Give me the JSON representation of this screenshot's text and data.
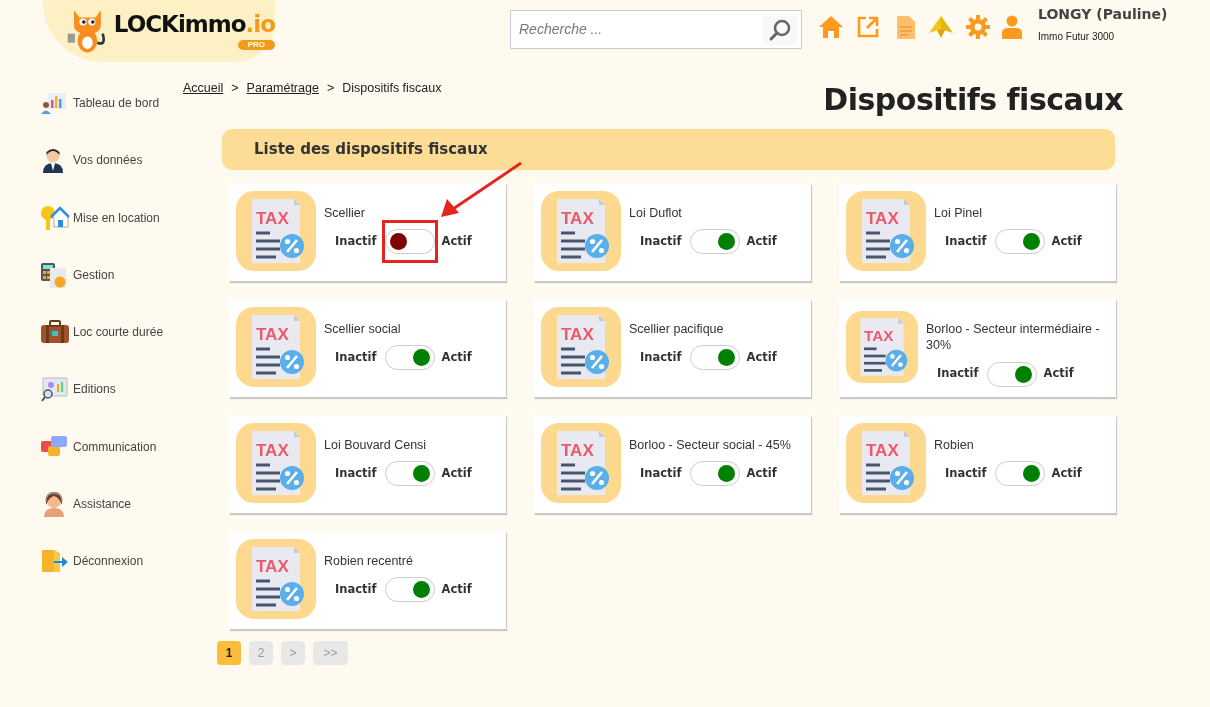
{
  "logo": {
    "name": "LOCKimmo",
    "suffix": ".io",
    "badge": "PRO"
  },
  "search": {
    "placeholder": "Recherche ..."
  },
  "user": {
    "name": "LONGY (Pauline)",
    "company": "Immo Futur 3000"
  },
  "sidebar": {
    "items": [
      {
        "label": "Tableau de bord",
        "kind": "dashboard"
      },
      {
        "label": "Vos données",
        "kind": "person"
      },
      {
        "label": "Mise en location",
        "kind": "key"
      },
      {
        "label": "Gestion",
        "kind": "calculator"
      },
      {
        "label": "Loc courte durée",
        "kind": "suitcase"
      },
      {
        "label": "Editions",
        "kind": "monitor"
      },
      {
        "label": "Communication",
        "kind": "chat"
      },
      {
        "label": "Assistance",
        "kind": "support"
      },
      {
        "label": "Déconnexion",
        "kind": "logout"
      }
    ]
  },
  "breadcrumb": [
    {
      "label": "Accueil",
      "link": true
    },
    {
      "label": "Paramétrage",
      "link": true
    },
    {
      "label": "Dispositifs fiscaux",
      "link": false
    }
  ],
  "breadcrumb_separator": ">",
  "page_title": "Dispositifs fiscaux",
  "section_title": "Liste des dispositifs fiscaux",
  "devices": [
    {
      "name": "Scellier",
      "icon_label": "TAX",
      "off_label": "Inactif",
      "on_label": "Actif",
      "on": false,
      "highlighted": true
    },
    {
      "name": "Loi Duflot",
      "icon_label": "TAX",
      "off_label": "Inactif",
      "on_label": "Actif",
      "on": true,
      "highlighted": false
    },
    {
      "name": "Loi Pinel",
      "icon_label": "TAX",
      "off_label": "Inactif",
      "on_label": "Actif",
      "on": true,
      "highlighted": false
    },
    {
      "name": "Scellier social",
      "icon_label": "TAX",
      "off_label": "Inactif",
      "on_label": "Actif",
      "on": true,
      "highlighted": false
    },
    {
      "name": "Scellier pacifique",
      "icon_label": "TAX",
      "off_label": "Inactif",
      "on_label": "Actif",
      "on": true,
      "highlighted": false
    },
    {
      "name": "Borloo - Secteur intermédiaire - 30%",
      "icon_label": "TAX",
      "off_label": "Inactif",
      "on_label": "Actif",
      "on": true,
      "highlighted": false
    },
    {
      "name": "Loi Bouvard Censi",
      "icon_label": "TAX",
      "off_label": "Inactif",
      "on_label": "Actif",
      "on": true,
      "highlighted": false
    },
    {
      "name": "Borloo - Secteur social - 45%",
      "icon_label": "TAX",
      "off_label": "Inactif",
      "on_label": "Actif",
      "on": true,
      "highlighted": false
    },
    {
      "name": "Robien",
      "icon_label": "TAX",
      "off_label": "Inactif",
      "on_label": "Actif",
      "on": true,
      "highlighted": false
    },
    {
      "name": "Robien recentré",
      "icon_label": "TAX",
      "off_label": "Inactif",
      "on_label": "Actif",
      "on": true,
      "highlighted": false
    }
  ],
  "pagination": [
    {
      "label": "1",
      "selected": true
    },
    {
      "label": "2",
      "selected": false
    },
    {
      "label": ">",
      "selected": false
    },
    {
      "label": ">>",
      "selected": false
    }
  ]
}
